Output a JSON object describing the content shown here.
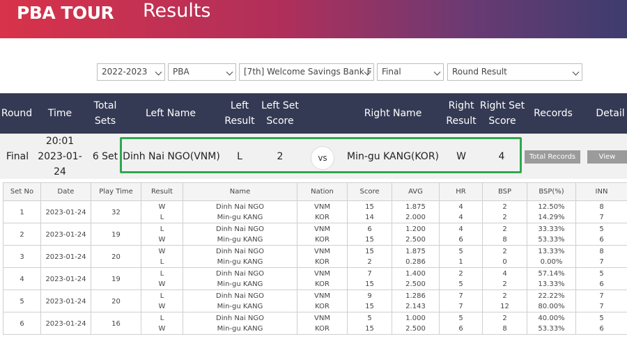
{
  "header": {
    "brand": "PBA TOUR",
    "title": "Results"
  },
  "filters": {
    "season": "2022-2023",
    "league": "PBA",
    "tournament": "[7th] Welcome Savings Bank F",
    "stage": "Final",
    "view": "Round Result"
  },
  "match_header": {
    "round": "Round",
    "time": "Time",
    "total_sets": "Total Sets",
    "left_name": "Left Name",
    "left_result": "Left Result",
    "left_set_score": "Left Set Score",
    "right_name": "Right Name",
    "right_result": "Right Result",
    "right_set_score": "Right Set Score",
    "records": "Records",
    "detail": "Detail"
  },
  "match": {
    "round": "Final",
    "time": "20:01",
    "date": "2023-01-24",
    "total_sets": "6 Set",
    "left_name": "Dinh Nai NGO(VNM)",
    "left_result": "L",
    "left_set_score": "2",
    "vs": "vs",
    "right_name": "Min-gu KANG(KOR)",
    "right_result": "W",
    "right_set_score": "4",
    "records_button": "Total Records",
    "detail_button": "View"
  },
  "sets_table": {
    "columns": [
      "Set No",
      "Date",
      "Play Time",
      "Result",
      "Name",
      "Nation",
      "Score",
      "AVG",
      "HR",
      "BSP",
      "BSP(%)",
      "INN"
    ],
    "rows": [
      {
        "set_no": "1",
        "date": "2023-01-24",
        "play_time": "32",
        "players": [
          {
            "result": "W",
            "name": "Dinh Nai NGO",
            "nation": "VNM",
            "score": "15",
            "avg": "1.875",
            "hr": "4",
            "bsp": "2",
            "bsp_pct": "12.50%",
            "inn": "8"
          },
          {
            "result": "L",
            "name": "Min-gu KANG",
            "nation": "KOR",
            "score": "14",
            "avg": "2.000",
            "hr": "4",
            "bsp": "2",
            "bsp_pct": "14.29%",
            "inn": "7"
          }
        ]
      },
      {
        "set_no": "2",
        "date": "2023-01-24",
        "play_time": "19",
        "players": [
          {
            "result": "L",
            "name": "Dinh Nai NGO",
            "nation": "VNM",
            "score": "6",
            "avg": "1.200",
            "hr": "4",
            "bsp": "2",
            "bsp_pct": "33.33%",
            "inn": "5"
          },
          {
            "result": "W",
            "name": "Min-gu KANG",
            "nation": "KOR",
            "score": "15",
            "avg": "2.500",
            "hr": "6",
            "bsp": "8",
            "bsp_pct": "53.33%",
            "inn": "6"
          }
        ]
      },
      {
        "set_no": "3",
        "date": "2023-01-24",
        "play_time": "20",
        "players": [
          {
            "result": "W",
            "name": "Dinh Nai NGO",
            "nation": "VNM",
            "score": "15",
            "avg": "1.875",
            "hr": "5",
            "bsp": "2",
            "bsp_pct": "13.33%",
            "inn": "8"
          },
          {
            "result": "L",
            "name": "Min-gu KANG",
            "nation": "KOR",
            "score": "2",
            "avg": "0.286",
            "hr": "1",
            "bsp": "0",
            "bsp_pct": "0.00%",
            "inn": "7"
          }
        ]
      },
      {
        "set_no": "4",
        "date": "2023-01-24",
        "play_time": "19",
        "players": [
          {
            "result": "L",
            "name": "Dinh Nai NGO",
            "nation": "VNM",
            "score": "7",
            "avg": "1.400",
            "hr": "2",
            "bsp": "4",
            "bsp_pct": "57.14%",
            "inn": "5"
          },
          {
            "result": "W",
            "name": "Min-gu KANG",
            "nation": "KOR",
            "score": "15",
            "avg": "2.500",
            "hr": "5",
            "bsp": "2",
            "bsp_pct": "13.33%",
            "inn": "6"
          }
        ]
      },
      {
        "set_no": "5",
        "date": "2023-01-24",
        "play_time": "20",
        "players": [
          {
            "result": "L",
            "name": "Dinh Nai NGO",
            "nation": "VNM",
            "score": "9",
            "avg": "1.286",
            "hr": "7",
            "bsp": "2",
            "bsp_pct": "22.22%",
            "inn": "7"
          },
          {
            "result": "W",
            "name": "Min-gu KANG",
            "nation": "KOR",
            "score": "15",
            "avg": "2.143",
            "hr": "7",
            "bsp": "12",
            "bsp_pct": "80.00%",
            "inn": "7"
          }
        ]
      },
      {
        "set_no": "6",
        "date": "2023-01-24",
        "play_time": "16",
        "players": [
          {
            "result": "L",
            "name": "Dinh Nai NGO",
            "nation": "VNM",
            "score": "5",
            "avg": "1.000",
            "hr": "5",
            "bsp": "2",
            "bsp_pct": "40.00%",
            "inn": "5"
          },
          {
            "result": "W",
            "name": "Min-gu KANG",
            "nation": "KOR",
            "score": "15",
            "avg": "2.500",
            "hr": "6",
            "bsp": "8",
            "bsp_pct": "53.33%",
            "inn": "6"
          }
        ]
      }
    ]
  }
}
